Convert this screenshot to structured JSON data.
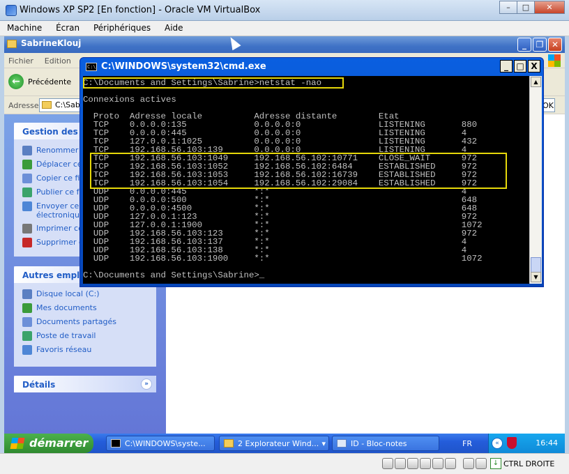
{
  "host": {
    "title": "Windows XP SP2 [En fonction] - Oracle VM VirtualBox",
    "menu": [
      "Machine",
      "Écran",
      "Périphériques",
      "Aide"
    ],
    "controls": {
      "minimize": "–",
      "maximize": "□",
      "close": "✕"
    },
    "status_icons": [
      "hard-disk-icon",
      "cd-icon",
      "pen-icon",
      "network-icon",
      "shared-folder-icon",
      "display-icon",
      "capture-icon",
      "mouse-integration-icon"
    ],
    "host_key_label": "CTRL DROITE"
  },
  "explorer": {
    "title": "SabrineKlouj",
    "menu": [
      "Fichier",
      "Edition"
    ],
    "back_label": "Précédente",
    "address_label": "Adresse",
    "address_value": "C:\\Sab",
    "go_label": "OK",
    "controls": {
      "minimize": "_",
      "maximize": "❐",
      "close": "✕"
    },
    "file_tasks": {
      "header": "Gestion des fi",
      "items": [
        {
          "label": "Renommer",
          "icon": "rename-icon"
        },
        {
          "label": "Déplacer ce",
          "icon": "move-icon"
        },
        {
          "label": "Copier ce fi",
          "icon": "copy-icon"
        },
        {
          "label": "Publier ce f",
          "icon": "publish-icon"
        },
        {
          "label": "Envoyer ce\nélectronique",
          "icon": "email-icon"
        },
        {
          "label": "Imprimer ce",
          "icon": "print-icon"
        },
        {
          "label": "Supprimer c",
          "icon": "delete-icon"
        }
      ]
    },
    "other_places": {
      "header": "Autres empla",
      "items": [
        {
          "label": "Disque local (C:)",
          "icon": "drive-icon"
        },
        {
          "label": "Mes documents",
          "icon": "folder-icon"
        },
        {
          "label": "Documents partagés",
          "icon": "shared-folder-icon"
        },
        {
          "label": "Poste de travail",
          "icon": "computer-icon"
        },
        {
          "label": "Favoris réseau",
          "icon": "network-icon"
        }
      ]
    },
    "details": {
      "header": "Détails",
      "chevron": "»"
    }
  },
  "cmd": {
    "title": "C:\\WINDOWS\\system32\\cmd.exe",
    "icon_text": "C:\\",
    "controls": {
      "minimize": "_",
      "maximize": "□",
      "close": "X"
    },
    "lines": [
      "C:\\Documents and Settings\\Sabrine>netstat -nao",
      "",
      "Connexions actives",
      "",
      "  Proto  Adresse locale          Adresse distante        Etat             ",
      "  TCP    0.0.0.0:135             0.0.0.0:0               LISTENING       880",
      "  TCP    0.0.0.0:445             0.0.0.0:0               LISTENING       4",
      "  TCP    127.0.0.1:1025          0.0.0.0:0               LISTENING       432",
      "  TCP    192.168.56.103:139      0.0.0.0:0               LISTENING       4",
      "  TCP    192.168.56.103:1049     192.168.56.102:10771    CLOSE_WAIT      972",
      "  TCP    192.168.56.103:1052     192.168.56.102:6484     ESTABLISHED     972",
      "  TCP    192.168.56.103:1053     192.168.56.102:16739    ESTABLISHED     972",
      "  TCP    192.168.56.103:1054     192.168.56.102:29084    ESTABLISHED     972",
      "  UDP    0.0.0.0:445             *:*                                     4",
      "  UDP    0.0.0.0:500             *:*                                     648",
      "  UDP    0.0.0.0:4500            *:*                                     648",
      "  UDP    127.0.0.1:123           *:*                                     972",
      "  UDP    127.0.0.1:1900          *:*                                     1072",
      "  UDP    192.168.56.103:123      *:*                                     972",
      "  UDP    192.168.56.103:137      *:*                                     4",
      "  UDP    192.168.56.103:138      *:*                                     4",
      "  UDP    192.168.56.103:1900     *:*                                     1072",
      "",
      "C:\\Documents and Settings\\Sabrine>_"
    ],
    "highlight_color": "#e6d80a"
  },
  "taskbar": {
    "start_label": "démarrer",
    "buttons": [
      {
        "label": "C:\\WINDOWS\\syste...",
        "icon": "cmd-icon"
      },
      {
        "label": "2 Explorateur Wind...",
        "icon": "folder-icon",
        "arrow": "▾"
      },
      {
        "label": "ID - Bloc-notes",
        "icon": "notepad-icon"
      }
    ],
    "language": "FR",
    "tray_arrow": "«",
    "clock": "16:44"
  }
}
